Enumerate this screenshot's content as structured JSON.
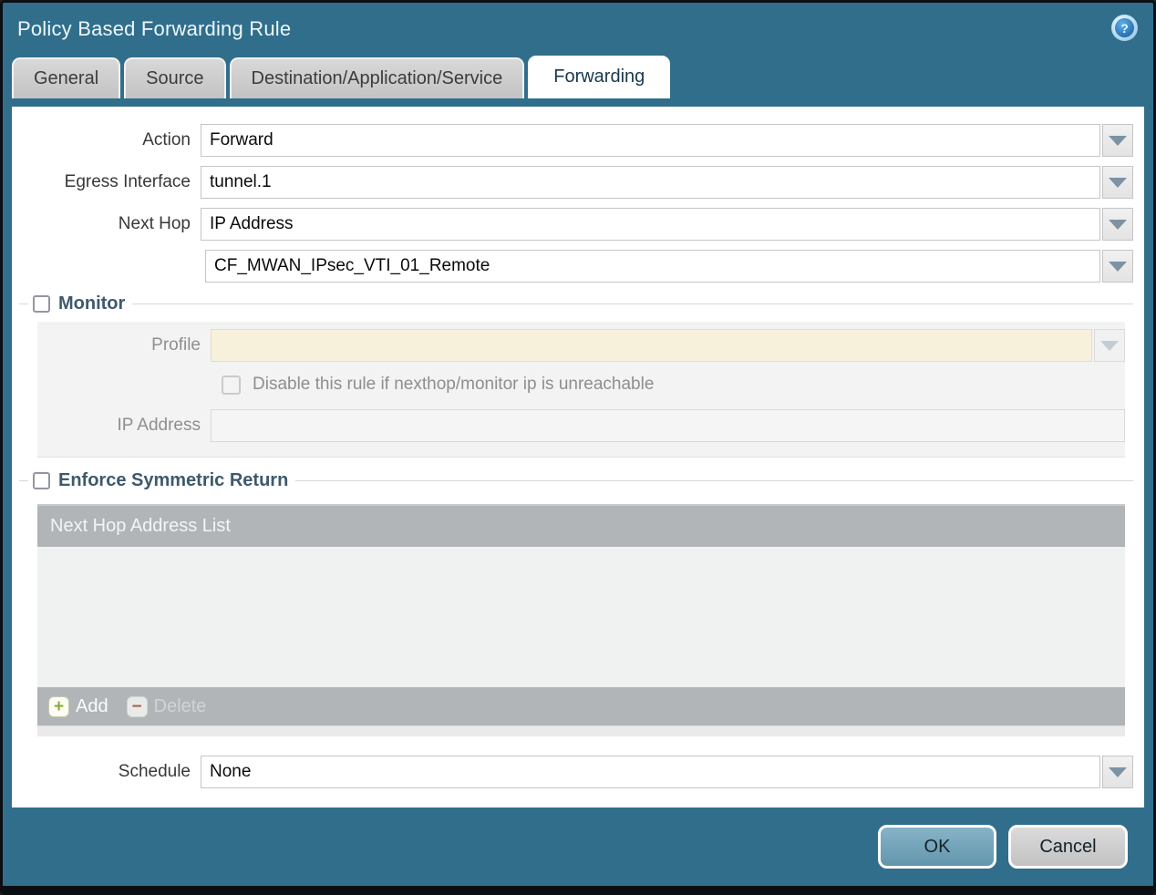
{
  "dialog": {
    "title": "Policy Based Forwarding Rule",
    "help_glyph": "?"
  },
  "tabs": [
    {
      "label": "General",
      "active": false
    },
    {
      "label": "Source",
      "active": false
    },
    {
      "label": "Destination/Application/Service",
      "active": false
    },
    {
      "label": "Forwarding",
      "active": true
    }
  ],
  "form": {
    "action": {
      "label": "Action",
      "value": "Forward"
    },
    "egress_interface": {
      "label": "Egress Interface",
      "value": "tunnel.1"
    },
    "next_hop": {
      "label": "Next Hop",
      "value": "IP Address"
    },
    "next_hop_address": {
      "value": "CF_MWAN_IPsec_VTI_01_Remote"
    },
    "schedule": {
      "label": "Schedule",
      "value": "None"
    }
  },
  "monitor": {
    "label": "Monitor",
    "checked": false,
    "profile": {
      "label": "Profile",
      "value": ""
    },
    "disable_rule": {
      "label": "Disable this rule if nexthop/monitor ip is unreachable",
      "checked": false
    },
    "ip_address": {
      "label": "IP Address",
      "value": ""
    }
  },
  "symmetric_return": {
    "label": "Enforce Symmetric Return",
    "checked": false,
    "list": {
      "header": "Next Hop Address List",
      "rows": [],
      "add_label": "Add",
      "delete_label": "Delete"
    }
  },
  "footer": {
    "ok_label": "OK",
    "cancel_label": "Cancel"
  },
  "colors": {
    "accent_teal": "#306e8c",
    "active_tab_text": "#18384f",
    "group_title": "#3d5a6b",
    "list_bar": "#b2b5b7",
    "disabled_field_cream": "#f7f0db",
    "ok_button": "#6f9fb5"
  }
}
